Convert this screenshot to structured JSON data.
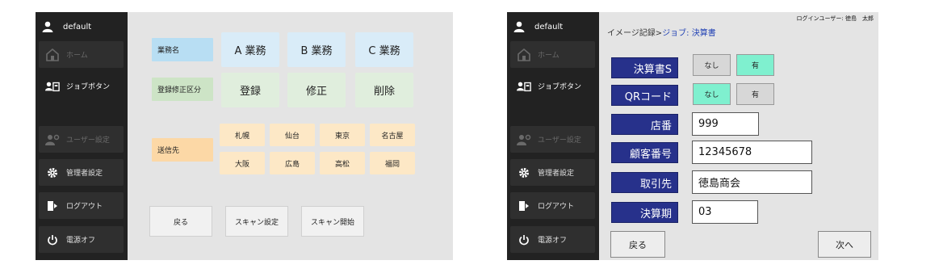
{
  "left_screen": {
    "user": "default",
    "sidebar": {
      "home": "ホーム",
      "job_button": "ジョブボタン",
      "user_settings": "ユーザー設定",
      "admin_settings": "管理者設定",
      "logout": "ログアウト",
      "power_off": "電源オフ"
    },
    "rows": {
      "business_name": "業務名",
      "register_edit_type": "登録修正区分",
      "destination": "送信先"
    },
    "business_buttons": [
      "A 業務",
      "B 業務",
      "C 業務"
    ],
    "action_buttons": [
      "登録",
      "修正",
      "削除"
    ],
    "destinations": [
      "札幌",
      "仙台",
      "東京",
      "名古屋",
      "大阪",
      "広島",
      "高松",
      "福岡"
    ],
    "bottom_buttons": {
      "back": "戻る",
      "scan_settings": "スキャン設定",
      "scan_start": "スキャン開始"
    }
  },
  "right_screen": {
    "user": "default",
    "sidebar": {
      "home": "ホーム",
      "job_button": "ジョブボタン",
      "user_settings": "ユーザー設定",
      "admin_settings": "管理者設定",
      "logout": "ログアウト",
      "power_off": "電源オフ"
    },
    "breadcrumb_prefix": "イメージ記録>",
    "breadcrumb_current": "ジョブ: 決算書",
    "login_user": "ログインユーザー: 徳島　太郎",
    "fields": [
      {
        "label": "決算書S"
      },
      {
        "label": "QRコード"
      },
      {
        "label": "店番",
        "value": "999"
      },
      {
        "label": "顧客番号",
        "value": "12345678"
      },
      {
        "label": "取引先",
        "value": "徳島商会"
      },
      {
        "label": "決算期",
        "value": "03"
      }
    ],
    "toggle_no": "なし",
    "toggle_yes": "有",
    "kessansho_selected": "有",
    "qr_selected": "なし",
    "back_button": "戻る",
    "next_button": "次へ"
  },
  "colors": {
    "sidebar_bg": "#222222",
    "panel_bg": "#e4e4e4",
    "business_blue": "#d9ecf8",
    "label_blue": "#b8def3",
    "action_green": "#e0eedd",
    "label_green": "#cde4c6",
    "destination_orange": "#fde8c6",
    "label_orange": "#fcd8a6",
    "field_label_navy": "#27318b",
    "toggle_active": "#7ff0cf",
    "breadcrumb_blue": "#2343b5"
  },
  "icons": [
    "user-icon",
    "home-icon",
    "job-button-icon",
    "user-settings-icon",
    "gear-icon",
    "logout-icon",
    "power-icon"
  ]
}
